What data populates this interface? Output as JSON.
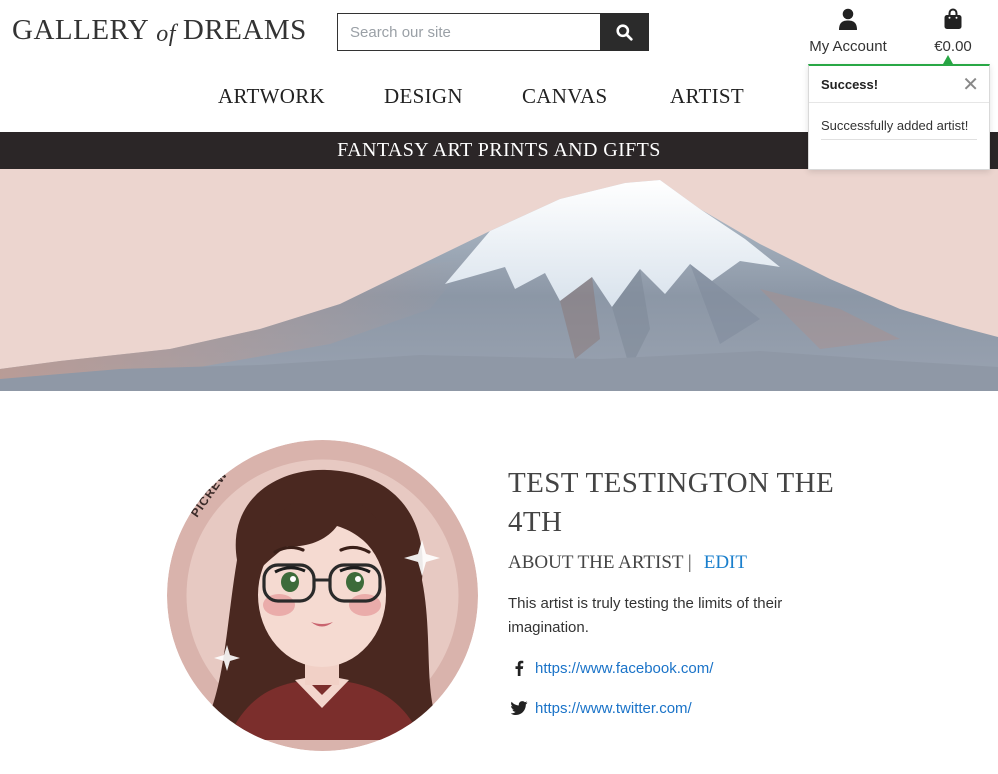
{
  "header": {
    "logo": {
      "part1": "GALLERY",
      "part2": "of",
      "part3": "DREAMS"
    },
    "search": {
      "placeholder": "Search our site",
      "icon": "search-icon"
    },
    "account": {
      "label": "My Account",
      "icon": "user-icon"
    },
    "bag": {
      "total": "€0.00",
      "icon": "shopping-bag-icon"
    }
  },
  "nav": {
    "items": [
      {
        "label": "ARTWORK"
      },
      {
        "label": "DESIGN"
      },
      {
        "label": "CANVAS"
      },
      {
        "label": "ARTIST"
      }
    ]
  },
  "banner": {
    "text": "FANTASY ART PRINTS AND GIFTS"
  },
  "toast": {
    "title": "Success!",
    "close": "✕",
    "message": "Successfully added artist!",
    "accent": "#28a745"
  },
  "artist": {
    "name": "TEST TESTINGTON THE 4TH",
    "about_label": "ABOUT THE ARTIST |",
    "edit_label": "EDIT",
    "bio": "This artist is truly testing the limits of their imagination.",
    "avatar_label": "PICREW",
    "social": [
      {
        "icon": "facebook-icon",
        "url": "https://www.facebook.com/"
      },
      {
        "icon": "twitter-icon",
        "url": "https://www.twitter.com/"
      }
    ]
  },
  "colors": {
    "banner_bg": "#2b2627",
    "hero_bg": "#ecd5cf",
    "link": "#1a73c8",
    "success": "#28a745"
  }
}
